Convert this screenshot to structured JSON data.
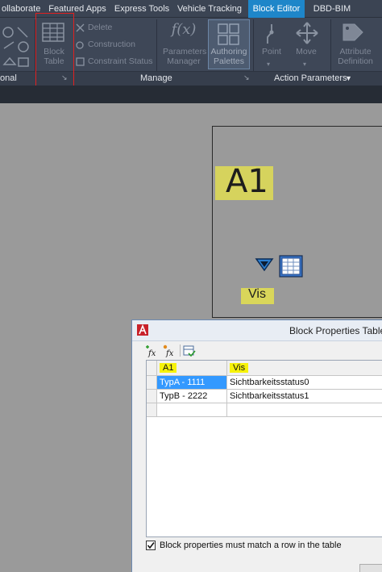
{
  "ribbon_tabs": [
    "ollaborate",
    "Featured Apps",
    "Express Tools",
    "Vehicle Tracking",
    "Block Editor",
    "DBD-BIM"
  ],
  "active_tab": "Block Editor",
  "ribbon": {
    "left_group_label": "onal",
    "block_table": {
      "line1": "Block",
      "line2": "Table"
    },
    "constraint_items": [
      "Delete",
      "Construction",
      "Constraint Status"
    ],
    "parameters_manager": {
      "line1": "Parameters",
      "line2": "Manager"
    },
    "authoring_palettes": {
      "line1": "Authoring",
      "line2": "Palettes"
    },
    "manage_label": "Manage",
    "point_label": "Point",
    "move_label": "Move",
    "action_parameters_label": "Action Parameters",
    "attribute_definition": {
      "line1": "Attribute",
      "line2": "Definition"
    }
  },
  "canvas": {
    "attribute_tag": "A1",
    "visibility_label": "Vis"
  },
  "dialog": {
    "title": "Block Properties Table",
    "columns": [
      "A1",
      "Vis"
    ],
    "rows": [
      {
        "a1": "TypA - 1111",
        "vis": "Sichtbarkeitsstatus0"
      },
      {
        "a1": "TypB - 2222",
        "vis": "Sichtbarkeitsstatus1"
      },
      {
        "a1": "",
        "vis": ""
      }
    ],
    "checkbox_label": "Block properties must match a row in the table",
    "checkbox_checked": true
  },
  "colors": {
    "active_tab": "#1e86c9",
    "highlight_yellow": "#d9d65a",
    "selection_blue": "#3399ff"
  }
}
